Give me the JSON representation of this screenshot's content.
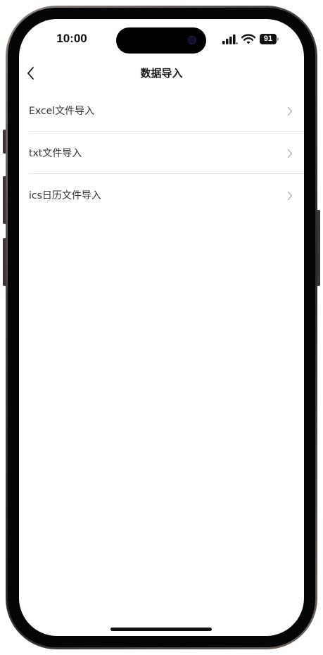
{
  "status_bar": {
    "time": "10:00",
    "battery_level": "91",
    "icons": [
      "signal-icon",
      "wifi-icon",
      "battery-icon"
    ]
  },
  "nav": {
    "title": "数据导入",
    "back_icon": "chevron-left-icon"
  },
  "import_options": [
    {
      "label": "Excel文件导入",
      "icon": "chevron-right-icon"
    },
    {
      "label": "txt文件导入",
      "icon": "chevron-right-icon"
    },
    {
      "label": "ics日历文件导入",
      "icon": "chevron-right-icon"
    }
  ],
  "colors": {
    "text_primary": "#333333",
    "title": "#1a1a1a",
    "chevron": "#b5b5b5",
    "divider": "#e6e6e6",
    "frame": "#4a4542"
  }
}
